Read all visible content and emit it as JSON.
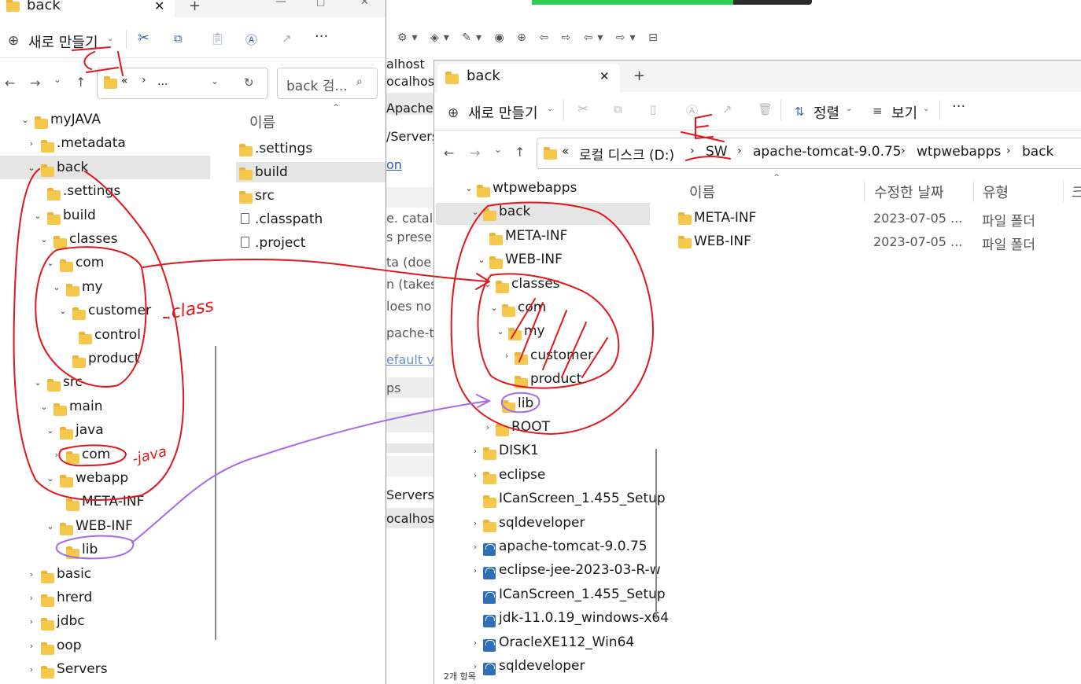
{
  "left_window": {
    "tab_title": "back",
    "new_button_label": "새로 만들기",
    "address": {
      "prefix": "«",
      "sep": "›",
      "ellipsis": "..."
    },
    "search_placeholder": "back 검...",
    "tree": [
      {
        "label": "myJAVA",
        "chev": "⌄"
      },
      {
        "label": ".metadata",
        "chev": "›"
      },
      {
        "label": "back",
        "chev": "⌄"
      },
      {
        "label": ".settings",
        "chev": ""
      },
      {
        "label": "build",
        "chev": "⌄"
      },
      {
        "label": "classes",
        "chev": "⌄"
      },
      {
        "label": "com",
        "chev": "⌄"
      },
      {
        "label": "my",
        "chev": "⌄"
      },
      {
        "label": "customer",
        "chev": "⌄"
      },
      {
        "label": "control",
        "chev": ""
      },
      {
        "label": "product",
        "chev": ""
      },
      {
        "label": "src",
        "chev": "⌄"
      },
      {
        "label": "main",
        "chev": "⌄"
      },
      {
        "label": "java",
        "chev": "⌄"
      },
      {
        "label": "com",
        "chev": "›"
      },
      {
        "label": "webapp",
        "chev": "⌄"
      },
      {
        "label": "META-INF",
        "chev": ""
      },
      {
        "label": "WEB-INF",
        "chev": "⌄"
      },
      {
        "label": "lib",
        "chev": ""
      },
      {
        "label": "basic",
        "chev": "›"
      },
      {
        "label": "hrerd",
        "chev": "›"
      },
      {
        "label": "jdbc",
        "chev": "›"
      },
      {
        "label": "oop",
        "chev": "›"
      },
      {
        "label": "Servers",
        "chev": "›"
      }
    ],
    "column_name": "이름",
    "files": [
      {
        "label": ".settings",
        "type": "folder"
      },
      {
        "label": "build",
        "type": "folder"
      },
      {
        "label": "src",
        "type": "folder"
      },
      {
        "label": ".classpath",
        "type": "file"
      },
      {
        "label": ".project",
        "type": "file"
      }
    ]
  },
  "eclipse_fragment": {
    "lines": [
      "alhost",
      "ocalhos",
      "Apache",
      "/Servers",
      "on",
      "e. catali",
      "s prese",
      "ta (doe",
      "n (takes",
      "loes no",
      "pache-t",
      "efault v",
      "ps",
      "Servers",
      "ocalhos"
    ]
  },
  "right_window": {
    "tab_title": "back",
    "new_button_label": "새로 만들기",
    "sort_label": "정렬",
    "view_label": "보기",
    "breadcrumb": [
      "«",
      "로컬 디스크 (D:)",
      "SW",
      "apache-tomcat-9.0.75",
      "wtpwebapps",
      "back"
    ],
    "tree": [
      {
        "label": "wtpwebapps",
        "chev": "⌄",
        "icon": "folder"
      },
      {
        "label": "back",
        "chev": "⌄",
        "icon": "folder"
      },
      {
        "label": "META-INF",
        "chev": "",
        "icon": "folder"
      },
      {
        "label": "WEB-INF",
        "chev": "⌄",
        "icon": "folder"
      },
      {
        "label": "classes",
        "chev": "⌄",
        "icon": "folder"
      },
      {
        "label": "com",
        "chev": "⌄",
        "icon": "folder"
      },
      {
        "label": "my",
        "chev": "⌄",
        "icon": "folder"
      },
      {
        "label": "customer",
        "chev": "›",
        "icon": "folder"
      },
      {
        "label": "product",
        "chev": "",
        "icon": "folder"
      },
      {
        "label": "lib",
        "chev": "",
        "icon": "folder"
      },
      {
        "label": "ROOT",
        "chev": "›",
        "icon": "folder"
      },
      {
        "label": "DISK1",
        "chev": "›",
        "icon": "folder"
      },
      {
        "label": "eclipse",
        "chev": "›",
        "icon": "folder"
      },
      {
        "label": "ICanScreen_1.455_Setup",
        "chev": "",
        "icon": "folder"
      },
      {
        "label": "sqldeveloper",
        "chev": "›",
        "icon": "folder"
      },
      {
        "label": "apache-tomcat-9.0.75",
        "chev": "›",
        "icon": "zip"
      },
      {
        "label": "eclipse-jee-2023-03-R-w",
        "chev": "›",
        "icon": "zip"
      },
      {
        "label": "ICanScreen_1.455_Setup",
        "chev": "",
        "icon": "zip"
      },
      {
        "label": "jdk-11.0.19_windows-x64",
        "chev": "",
        "icon": "zip"
      },
      {
        "label": "OracleXE112_Win64",
        "chev": "›",
        "icon": "zip"
      },
      {
        "label": "sqldeveloper",
        "chev": "›",
        "icon": "zip"
      }
    ],
    "columns": {
      "name": "이름",
      "date": "수정한 날짜",
      "type": "유형",
      "size": "크"
    },
    "files": [
      {
        "name": "META-INF",
        "date": "2023-07-05 ...",
        "type": "파일 폴더"
      },
      {
        "name": "WEB-INF",
        "date": "2023-07-05 ...",
        "type": "파일 폴더"
      }
    ],
    "status": "2개 항목"
  },
  "annotations": {
    "class_note": ".class",
    "java_note": "-java",
    "e_note": "E"
  },
  "colors": {
    "pen_red": "#e3161b",
    "pen_purple": "#a66be8",
    "selection": "#e5e5e5",
    "folder": "#f5c74a",
    "progress_green": "#2ecc52"
  }
}
